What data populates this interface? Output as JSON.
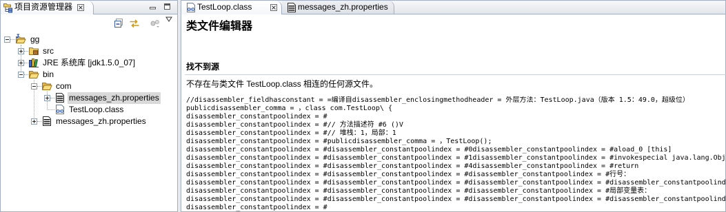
{
  "explorer": {
    "tab_title": "项目资源管理器",
    "tab_icon": "project-explorer-icon",
    "window_controls": [
      "minimize-icon",
      "maximize-icon"
    ],
    "toolbar_icons": [
      "collapse-all-icon",
      "link-with-editor-icon",
      "focus-active-task-icon",
      "view-menu-icon"
    ],
    "tree": {
      "label": "gg",
      "icon": "java-project-icon",
      "state": "expanded",
      "children": [
        {
          "label": "src",
          "icon": "source-folder-icon",
          "state": "collapsed"
        },
        {
          "label": "JRE 系统库 [jdk1.5.0_07]",
          "icon": "jre-library-icon",
          "state": "collapsed"
        },
        {
          "label": "bin",
          "icon": "folder-icon",
          "state": "expanded",
          "children": [
            {
              "label": "com",
              "icon": "folder-icon",
              "state": "expanded",
              "children": [
                {
                  "label": "messages_zh.properties",
                  "icon": "properties-file-icon",
                  "state": "collapsed",
                  "selected": true
                },
                {
                  "label": "TestLoop.class",
                  "icon": "class-file-icon",
                  "state": "leaf"
                }
              ]
            },
            {
              "label": "messages_zh.properties",
              "icon": "properties-file-icon",
              "state": "collapsed"
            }
          ]
        }
      ]
    }
  },
  "editor": {
    "tabs": [
      {
        "label": "TestLoop.class",
        "icon": "class-file-icon",
        "active": true,
        "closable": true
      },
      {
        "label": "messages_zh.properties",
        "icon": "properties-file-icon",
        "active": false
      }
    ],
    "title": "类文件编辑器",
    "section_title": "找不到源",
    "message": "不存在与类文件 TestLoop.class 相连的任何源文件。",
    "code_lines": [
      "//disassembler_fieldhasconstant = =编译自disassembler_enclosingmethodheader = 外层方法：TestLoop.java（版本 1.5：49.0，超级位）",
      "publicdisassembler_comma = ，class com.TestLoop\\ {",
      "disassembler_constantpoolindex = #",
      "disassembler_constantpoolindex = #// 方法描述符 #6 ()V",
      "disassembler_constantpoolindex = #// 堆栈：1，局部：1",
      "disassembler_constantpoolindex = #publicdisassembler_comma = ，TestLoop();",
      "disassembler_constantpoolindex = #disassembler_constantpoolindex = #0disassembler_constantpoolindex = #aload_0 [this]",
      "disassembler_constantpoolindex = #disassembler_constantpoolindex = #1disassembler_constantpoolindex = #invokespecial java.lang.Obje",
      "disassembler_constantpoolindex = #disassembler_constantpoolindex = #4disassembler_constantpoolindex = #return",
      "disassembler_constantpoolindex = #disassembler_constantpoolindex = #disassembler_constantpoolindex = #行号：",
      "disassembler_constantpoolindex = #disassembler_constantpoolindex = #disassembler_constantpoolindex = #disassembler_constantpoolinde",
      "disassembler_constantpoolindex = #disassembler_constantpoolindex = #disassembler_constantpoolindex = #局部变量表：",
      "disassembler_constantpoolindex = #disassembler_constantpoolindex = #disassembler_constantpoolindex = #disassembler_constantpoolinde",
      "disassembler_constantpoolindex = #"
    ]
  },
  "colors": {
    "selection": "#d9d9d9",
    "panel_border": "#a3afc0"
  }
}
